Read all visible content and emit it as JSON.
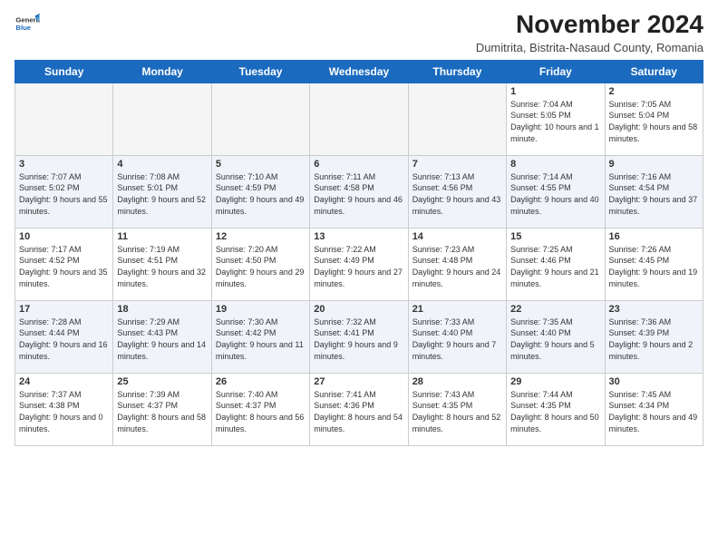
{
  "logo": {
    "general": "General",
    "blue": "Blue"
  },
  "header": {
    "month_year": "November 2024",
    "location": "Dumitrita, Bistrita-Nasaud County, Romania"
  },
  "days_of_week": [
    "Sunday",
    "Monday",
    "Tuesday",
    "Wednesday",
    "Thursday",
    "Friday",
    "Saturday"
  ],
  "weeks": [
    [
      {
        "day": "",
        "info": ""
      },
      {
        "day": "",
        "info": ""
      },
      {
        "day": "",
        "info": ""
      },
      {
        "day": "",
        "info": ""
      },
      {
        "day": "",
        "info": ""
      },
      {
        "day": "1",
        "info": "Sunrise: 7:04 AM\nSunset: 5:05 PM\nDaylight: 10 hours and 1 minute."
      },
      {
        "day": "2",
        "info": "Sunrise: 7:05 AM\nSunset: 5:04 PM\nDaylight: 9 hours and 58 minutes."
      }
    ],
    [
      {
        "day": "3",
        "info": "Sunrise: 7:07 AM\nSunset: 5:02 PM\nDaylight: 9 hours and 55 minutes."
      },
      {
        "day": "4",
        "info": "Sunrise: 7:08 AM\nSunset: 5:01 PM\nDaylight: 9 hours and 52 minutes."
      },
      {
        "day": "5",
        "info": "Sunrise: 7:10 AM\nSunset: 4:59 PM\nDaylight: 9 hours and 49 minutes."
      },
      {
        "day": "6",
        "info": "Sunrise: 7:11 AM\nSunset: 4:58 PM\nDaylight: 9 hours and 46 minutes."
      },
      {
        "day": "7",
        "info": "Sunrise: 7:13 AM\nSunset: 4:56 PM\nDaylight: 9 hours and 43 minutes."
      },
      {
        "day": "8",
        "info": "Sunrise: 7:14 AM\nSunset: 4:55 PM\nDaylight: 9 hours and 40 minutes."
      },
      {
        "day": "9",
        "info": "Sunrise: 7:16 AM\nSunset: 4:54 PM\nDaylight: 9 hours and 37 minutes."
      }
    ],
    [
      {
        "day": "10",
        "info": "Sunrise: 7:17 AM\nSunset: 4:52 PM\nDaylight: 9 hours and 35 minutes."
      },
      {
        "day": "11",
        "info": "Sunrise: 7:19 AM\nSunset: 4:51 PM\nDaylight: 9 hours and 32 minutes."
      },
      {
        "day": "12",
        "info": "Sunrise: 7:20 AM\nSunset: 4:50 PM\nDaylight: 9 hours and 29 minutes."
      },
      {
        "day": "13",
        "info": "Sunrise: 7:22 AM\nSunset: 4:49 PM\nDaylight: 9 hours and 27 minutes."
      },
      {
        "day": "14",
        "info": "Sunrise: 7:23 AM\nSunset: 4:48 PM\nDaylight: 9 hours and 24 minutes."
      },
      {
        "day": "15",
        "info": "Sunrise: 7:25 AM\nSunset: 4:46 PM\nDaylight: 9 hours and 21 minutes."
      },
      {
        "day": "16",
        "info": "Sunrise: 7:26 AM\nSunset: 4:45 PM\nDaylight: 9 hours and 19 minutes."
      }
    ],
    [
      {
        "day": "17",
        "info": "Sunrise: 7:28 AM\nSunset: 4:44 PM\nDaylight: 9 hours and 16 minutes."
      },
      {
        "day": "18",
        "info": "Sunrise: 7:29 AM\nSunset: 4:43 PM\nDaylight: 9 hours and 14 minutes."
      },
      {
        "day": "19",
        "info": "Sunrise: 7:30 AM\nSunset: 4:42 PM\nDaylight: 9 hours and 11 minutes."
      },
      {
        "day": "20",
        "info": "Sunrise: 7:32 AM\nSunset: 4:41 PM\nDaylight: 9 hours and 9 minutes."
      },
      {
        "day": "21",
        "info": "Sunrise: 7:33 AM\nSunset: 4:40 PM\nDaylight: 9 hours and 7 minutes."
      },
      {
        "day": "22",
        "info": "Sunrise: 7:35 AM\nSunset: 4:40 PM\nDaylight: 9 hours and 5 minutes."
      },
      {
        "day": "23",
        "info": "Sunrise: 7:36 AM\nSunset: 4:39 PM\nDaylight: 9 hours and 2 minutes."
      }
    ],
    [
      {
        "day": "24",
        "info": "Sunrise: 7:37 AM\nSunset: 4:38 PM\nDaylight: 9 hours and 0 minutes."
      },
      {
        "day": "25",
        "info": "Sunrise: 7:39 AM\nSunset: 4:37 PM\nDaylight: 8 hours and 58 minutes."
      },
      {
        "day": "26",
        "info": "Sunrise: 7:40 AM\nSunset: 4:37 PM\nDaylight: 8 hours and 56 minutes."
      },
      {
        "day": "27",
        "info": "Sunrise: 7:41 AM\nSunset: 4:36 PM\nDaylight: 8 hours and 54 minutes."
      },
      {
        "day": "28",
        "info": "Sunrise: 7:43 AM\nSunset: 4:35 PM\nDaylight: 8 hours and 52 minutes."
      },
      {
        "day": "29",
        "info": "Sunrise: 7:44 AM\nSunset: 4:35 PM\nDaylight: 8 hours and 50 minutes."
      },
      {
        "day": "30",
        "info": "Sunrise: 7:45 AM\nSunset: 4:34 PM\nDaylight: 8 hours and 49 minutes."
      }
    ]
  ]
}
